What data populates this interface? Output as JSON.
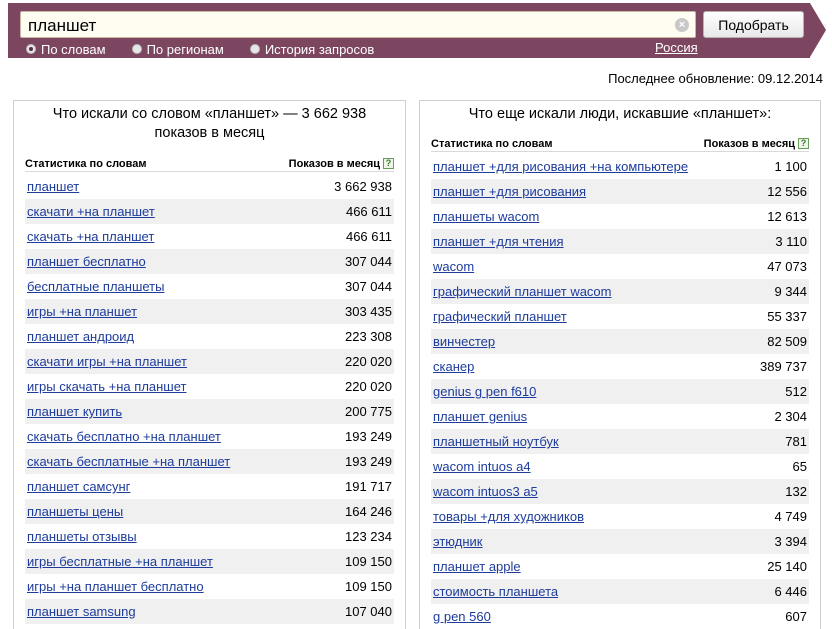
{
  "search": {
    "query": "планшет",
    "submit_label": "Подобрать",
    "options": [
      "По словам",
      "По регионам",
      "История запросов"
    ],
    "selected_option": 0,
    "region": "Россия"
  },
  "last_update": "Последнее обновление: 09.12.2014",
  "left_panel": {
    "title": "Что искали со словом «планшет» — 3 662 938 показов в месяц",
    "col_keyword": "Статистика по словам",
    "col_count": "Показов в месяц",
    "rows": [
      {
        "kw": "планшет",
        "cnt": "3 662 938"
      },
      {
        "kw": "скачати +на планшет",
        "cnt": "466 611"
      },
      {
        "kw": "скачать +на планшет",
        "cnt": "466 611"
      },
      {
        "kw": "планшет бесплатно",
        "cnt": "307 044"
      },
      {
        "kw": "бесплатные планшеты",
        "cnt": "307 044"
      },
      {
        "kw": "игры +на планшет",
        "cnt": "303 435"
      },
      {
        "kw": "планшет андроид",
        "cnt": "223 308"
      },
      {
        "kw": "скачати игры +на планшет",
        "cnt": "220 020"
      },
      {
        "kw": "игры скачать +на планшет",
        "cnt": "220 020"
      },
      {
        "kw": "планшет купить",
        "cnt": "200 775"
      },
      {
        "kw": "скачать бесплатно +на планшет",
        "cnt": "193 249"
      },
      {
        "kw": "скачать бесплатные +на планшет",
        "cnt": "193 249"
      },
      {
        "kw": "планшет самсунг",
        "cnt": "191 717"
      },
      {
        "kw": "планшеты цены",
        "cnt": "164 246"
      },
      {
        "kw": "планшеты отзывы",
        "cnt": "123 234"
      },
      {
        "kw": "игры бесплатные +на планшет",
        "cnt": "109 150"
      },
      {
        "kw": "игры +на планшет бесплатно",
        "cnt": "109 150"
      },
      {
        "kw": "планшет samsung",
        "cnt": "107 040"
      }
    ]
  },
  "right_panel": {
    "title": "Что еще искали люди, искавшие «планшет»:",
    "col_keyword": "Статистика по словам",
    "col_count": "Показов в месяц",
    "rows": [
      {
        "kw": "планшет +для рисования +на компьютере",
        "cnt": "1 100"
      },
      {
        "kw": "планшет +для рисования",
        "cnt": "12 556"
      },
      {
        "kw": "планшеты wacom",
        "cnt": "12 613"
      },
      {
        "kw": "планшет +для чтения",
        "cnt": "3 110"
      },
      {
        "kw": "wacom",
        "cnt": "47 073"
      },
      {
        "kw": "графический планшет wacom",
        "cnt": "9 344"
      },
      {
        "kw": "графический планшет",
        "cnt": "55 337"
      },
      {
        "kw": "винчестер",
        "cnt": "82 509"
      },
      {
        "kw": "сканер",
        "cnt": "389 737"
      },
      {
        "kw": "genius g pen f610",
        "cnt": "512"
      },
      {
        "kw": "планшет genius",
        "cnt": "2 304"
      },
      {
        "kw": "планшетный ноутбук",
        "cnt": "781"
      },
      {
        "kw": "wacom intuos a4",
        "cnt": "65"
      },
      {
        "kw": "wacom intuos3 a5",
        "cnt": "132"
      },
      {
        "kw": "товары +для художников",
        "cnt": "4 749"
      },
      {
        "kw": "этюдник",
        "cnt": "3 394"
      },
      {
        "kw": "планшет apple",
        "cnt": "25 140"
      },
      {
        "kw": "стоимость планшета",
        "cnt": "6 446"
      },
      {
        "kw": "g pen 560",
        "cnt": "607"
      }
    ]
  },
  "colors": {
    "header_bg": "#7d4660",
    "link": "#1d3c9c",
    "row_stripe": "#f0f0f0"
  },
  "icons": {
    "clear": "clear-icon",
    "help": "help-icon",
    "radio": "radio-icon"
  }
}
